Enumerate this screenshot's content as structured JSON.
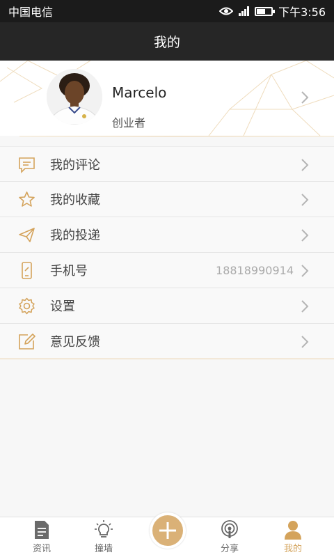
{
  "status_bar": {
    "carrier": "中国电信",
    "time": "下午3:56"
  },
  "header": {
    "title": "我的"
  },
  "profile": {
    "name": "Marcelo",
    "role": "创业者"
  },
  "menu": [
    {
      "label": "我的评论",
      "icon": "comment-icon"
    },
    {
      "label": "我的收藏",
      "icon": "star-icon"
    },
    {
      "label": "我的投递",
      "icon": "send-icon"
    },
    {
      "label": "手机号",
      "icon": "phone-icon",
      "value": "18818990914"
    },
    {
      "label": "设置",
      "icon": "gear-icon"
    },
    {
      "label": "意见反馈",
      "icon": "edit-icon"
    }
  ],
  "bottom_nav": [
    {
      "label": "资讯",
      "icon": "document-icon"
    },
    {
      "label": "撞墙",
      "icon": "lightbulb-icon"
    },
    {
      "label": "分享",
      "icon": "podcast-icon"
    },
    {
      "label": "我的",
      "icon": "person-icon",
      "active": true
    }
  ],
  "colors": {
    "accent": "#d4a35b",
    "header_bg": "#262626",
    "status_bg": "#1b1b1b"
  }
}
